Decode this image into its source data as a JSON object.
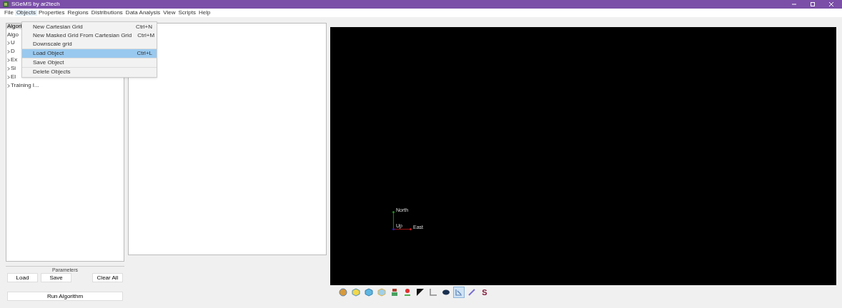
{
  "window": {
    "title": "SGeMS by ar2tech"
  },
  "menu_bar": [
    {
      "label": "File",
      "selected": false
    },
    {
      "label": "Objects",
      "selected": true
    },
    {
      "label": "Properties",
      "selected": false
    },
    {
      "label": "Regions",
      "selected": false
    },
    {
      "label": "Distributions",
      "selected": false
    },
    {
      "label": "Data Analysis",
      "selected": false
    },
    {
      "label": "View",
      "selected": false
    },
    {
      "label": "Scripts",
      "selected": false
    },
    {
      "label": "Help",
      "selected": false
    }
  ],
  "objects_menu": [
    {
      "label": "New Cartesian Grid",
      "shortcut": "Ctrl+N",
      "selected": false,
      "separator_after": false
    },
    {
      "label": "New Masked Grid From Cartesian Grid",
      "shortcut": "Ctrl+M",
      "selected": false,
      "separator_after": false
    },
    {
      "label": "Downscale grid",
      "selected": false,
      "separator_after": true
    },
    {
      "label": "Load Object",
      "shortcut": "Ctrl+L",
      "selected": true,
      "separator_after": true
    },
    {
      "label": "Save Object",
      "selected": false,
      "separator_after": true
    },
    {
      "label": "Delete Objects",
      "selected": false,
      "separator_after": false
    }
  ],
  "left_panel": {
    "tab": "Algori",
    "heading": "Algo",
    "tree": [
      {
        "label": "U",
        "expanded": false
      },
      {
        "label": "D",
        "expanded": false
      },
      {
        "label": "Ex",
        "expanded": false
      },
      {
        "label": "Si",
        "expanded": false
      },
      {
        "label": "El",
        "expanded": false
      },
      {
        "label": "Training I...",
        "expanded": false
      }
    ],
    "parameters": {
      "title": "Parameters",
      "buttons": [
        "Load",
        "Save",
        "Clear All"
      ]
    },
    "run_button": "Run Algorithm"
  },
  "viewer": {
    "axes": {
      "north": "North",
      "east": "East",
      "up": "Up"
    }
  },
  "toolbar": [
    {
      "kind": "globe",
      "selected": false
    },
    {
      "kind": "cube-yellow",
      "selected": false
    },
    {
      "kind": "cube-blue",
      "selected": false
    },
    {
      "kind": "cube-light",
      "selected": false
    },
    {
      "kind": "figure",
      "selected": false
    },
    {
      "kind": "pin",
      "selected": false
    },
    {
      "kind": "contrast",
      "selected": false
    },
    {
      "kind": "axis",
      "selected": false
    },
    {
      "kind": "camera",
      "selected": false
    },
    {
      "kind": "view",
      "selected": true
    },
    {
      "kind": "scale",
      "selected": false
    },
    {
      "kind": "text",
      "label": "S",
      "selected": false
    }
  ]
}
